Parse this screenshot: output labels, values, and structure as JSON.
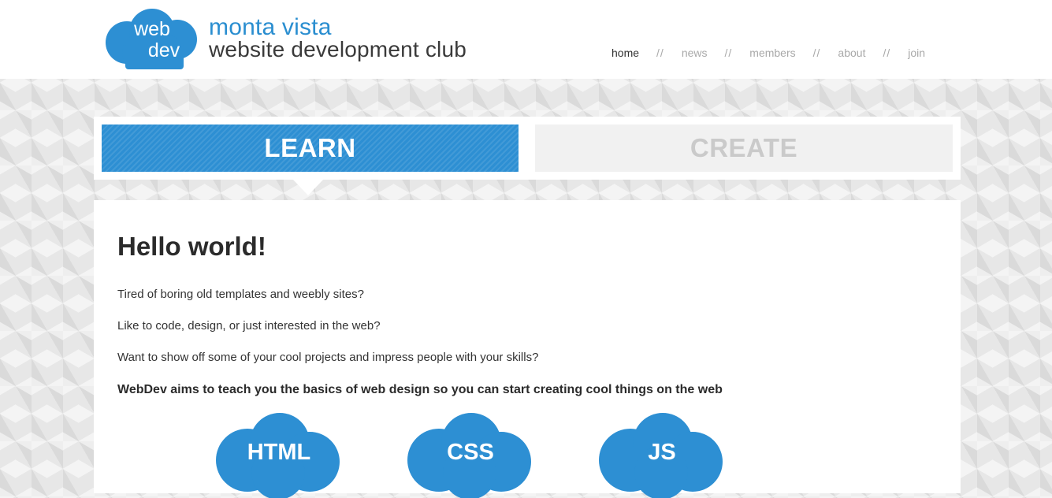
{
  "header": {
    "logo": {
      "line1": "web",
      "line2": "dev",
      "color": "#2d8fd3"
    },
    "brand_name": "monta vista",
    "brand_subtitle": "website development club",
    "nav": [
      {
        "label": "home",
        "active": true
      },
      {
        "label": "news",
        "active": false
      },
      {
        "label": "members",
        "active": false
      },
      {
        "label": "about",
        "active": false
      },
      {
        "label": "join",
        "active": false
      }
    ],
    "nav_separator": "//"
  },
  "tabs": {
    "learn": "LEARN",
    "create": "CREATE",
    "active": "LEARN"
  },
  "content": {
    "heading": "Hello world!",
    "paragraphs": [
      "Tired of boring old templates and weebly sites?",
      "Like to code, design, or just interested in the web?",
      "Want to show off some of your cool projects and impress people with your skills?"
    ],
    "tagline": "WebDev aims to teach you the basics of web design so you can start creating cool things on the web",
    "clouds": [
      {
        "label": "HTML",
        "icon": "cloud-icon"
      },
      {
        "label": "CSS",
        "icon": "cloud-icon"
      },
      {
        "label": "JS",
        "icon": "cloud-icon"
      }
    ]
  },
  "colors": {
    "accent": "#2d8fd3",
    "text_dark": "#2b2b2b",
    "nav_muted": "#a9a9a9"
  }
}
